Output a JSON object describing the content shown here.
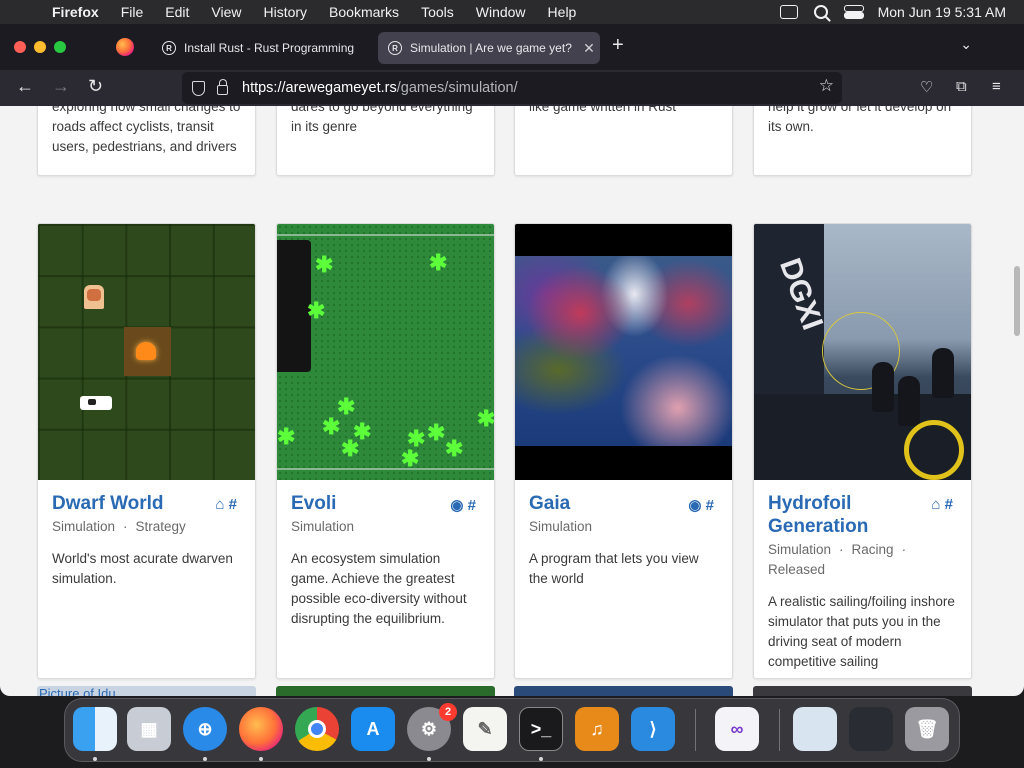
{
  "menubar": {
    "apple": "",
    "items": [
      "Firefox",
      "File",
      "Edit",
      "View",
      "History",
      "Bookmarks",
      "Tools",
      "Window",
      "Help"
    ],
    "datetime": "Mon Jun 19  5:31 AM"
  },
  "browser": {
    "tabs": [
      {
        "title": "Install Rust - Rust Programming",
        "active": false
      },
      {
        "title": "Simulation | Are we game yet?",
        "active": true
      }
    ],
    "url_host": "https://arewegameyet.rs",
    "url_path": "/games/simulation/"
  },
  "top_cards": [
    {
      "desc": "exploring how small changes to roads affect cyclists, transit users, pedestrians, and drivers"
    },
    {
      "desc": "dares to go beyond everything in its genre"
    },
    {
      "desc": "like game written in Rust"
    },
    {
      "desc": "help it grow or let it develop on its own."
    }
  ],
  "games": [
    {
      "name": "Dwarf World",
      "icons": "⌂ #",
      "tags": [
        "Simulation",
        "Strategy"
      ],
      "description": "World's most acurate dwarven simulation."
    },
    {
      "name": "Evoli",
      "icons": "◉ #",
      "tags": [
        "Simulation"
      ],
      "description": "An ecosystem simulation game. Achieve the greatest possible eco-diversity without disrupting the equilibrium."
    },
    {
      "name": "Gaia",
      "icons": "◉ #",
      "tags": [
        "Simulation"
      ],
      "description": "A program that lets you view the world"
    },
    {
      "name": "Hydrofoil Generation",
      "icons": "⌂ #",
      "tags": [
        "Simulation",
        "Racing",
        "Released"
      ],
      "description": "A realistic sailing/foiling inshore simulator that puts you in the driving seat of modern competitive sailing"
    }
  ],
  "bottom_cards": {
    "first_label": "Picture of Idu"
  },
  "hydro_sail_text": "DGXI",
  "dock": {
    "badge_count": "2",
    "apps": [
      "finder-icon",
      "launchpad-icon",
      "safari-icon",
      "firefox-icon",
      "chrome-icon",
      "app-store-icon",
      "system-settings-icon",
      "textedit-icon",
      "terminal-icon",
      "garageband-icon",
      "vscode-icon",
      "visual-studio-icon",
      "downloads-folder-icon",
      "screenshot-stack-icon",
      "trash-icon"
    ]
  }
}
